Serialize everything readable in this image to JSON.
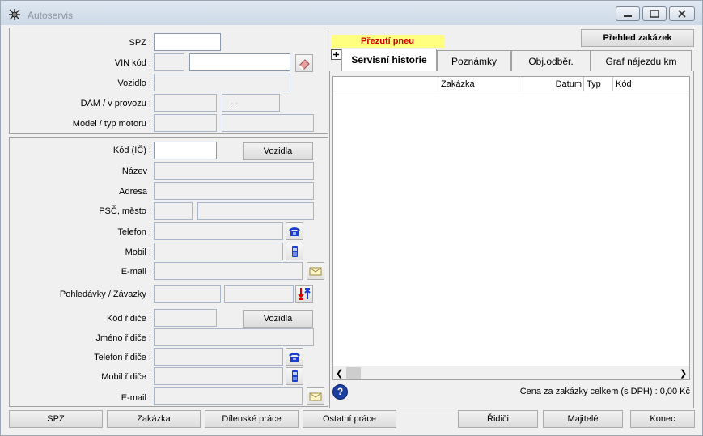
{
  "window": {
    "title": "Autoservis"
  },
  "vehicle": {
    "spz_label": "SPZ :",
    "spz_value": "",
    "vin_label": "VIN kód :",
    "vozidlo_label": "Vozidlo :",
    "dam_label": "DAM / v provozu :",
    "dam_date": " .  .",
    "model_label": "Model / typ motoru :"
  },
  "owner": {
    "kod_label": "Kód (IČ) :",
    "vozidla_button": "Vozidla",
    "nazev_label": "Název",
    "adresa_label": "Adresa",
    "psc_label": "PSČ, město :",
    "telefon_label": "Telefon :",
    "mobil_label": "Mobil :",
    "email_label": "E-mail :",
    "pohledavky_label": "Pohledávky / Závazky :"
  },
  "driver": {
    "kod_label": "Kód řidiče :",
    "vozidla_button": "Vozidla",
    "jmeno_label": "Jméno řidiče :",
    "telefon_label": "Telefon řidiče :",
    "mobil_label": "Mobil řidiče :",
    "email_label": "E-mail :"
  },
  "right": {
    "tire_badge": "Přezutí pneu",
    "overview_button": "Přehled zakázek",
    "tabs": [
      "Servisní historie",
      "Poznámky",
      "Obj.odběr.",
      "Graf nájezdu km"
    ],
    "columns": [
      "Zakázka",
      "Datum",
      "Typ",
      "Kód"
    ],
    "total_text": "Cena za zakázky celkem (s DPH) : 0,00 Kč"
  },
  "bottom": {
    "buttons": [
      "SPZ",
      "Zakázka",
      "Dílenské práce",
      "Ostatní práce",
      "Řidiči",
      "Majitelé",
      "Konec"
    ]
  },
  "colors": {
    "badge_bg": "#ffff80",
    "badge_text": "#d00000",
    "field_border": "#a9b6c8"
  }
}
